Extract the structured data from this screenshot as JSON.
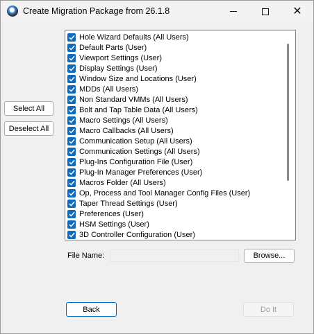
{
  "window": {
    "title": "Create Migration Package from 26.1.8",
    "controls": {
      "minimize": "—",
      "maximize": "☐",
      "close": "✕"
    }
  },
  "left_buttons": {
    "select_all": "Select All",
    "deselect_all": "Deselect All"
  },
  "items": [
    {
      "label": "Hole Wizard Defaults (All Users)",
      "checked": true
    },
    {
      "label": "Default Parts (User)",
      "checked": true
    },
    {
      "label": "Viewport Settings (User)",
      "checked": true
    },
    {
      "label": "Display Settings (User)",
      "checked": true
    },
    {
      "label": "Window Size and Locations (User)",
      "checked": true
    },
    {
      "label": "MDDs (All Users)",
      "checked": true
    },
    {
      "label": "Non Standard VMMs (All Users)",
      "checked": true
    },
    {
      "label": "Bolt and Tap Table Data (All Users)",
      "checked": true
    },
    {
      "label": "Macro Settings (All Users)",
      "checked": true
    },
    {
      "label": "Macro Callbacks (All Users)",
      "checked": true
    },
    {
      "label": "Communication Setup (All Users)",
      "checked": true
    },
    {
      "label": "Communication Settings (All Users)",
      "checked": true
    },
    {
      "label": "Plug-Ins Configuration File (User)",
      "checked": true
    },
    {
      "label": "Plug-In Manager Preferences (User)",
      "checked": true
    },
    {
      "label": "Macros Folder (All Users)",
      "checked": true
    },
    {
      "label": "Op, Process and Tool Manager Config Files (User)",
      "checked": true
    },
    {
      "label": "Taper Thread Settings (User)",
      "checked": true
    },
    {
      "label": "Preferences (User)",
      "checked": true
    },
    {
      "label": "HSM Settings (User)",
      "checked": true
    },
    {
      "label": "3D Controller Configuration (User)",
      "checked": true
    }
  ],
  "file": {
    "label": "File Name:",
    "value": "",
    "browse": "Browse..."
  },
  "footer": {
    "back": "Back",
    "do_it": "Do It"
  },
  "colors": {
    "checkbox": "#0f6cbd",
    "back_border": "#0067c0",
    "disabled_text": "#9c9c9c"
  },
  "icons": {
    "app": "app-logo-icon",
    "check": "checkmark-icon"
  }
}
